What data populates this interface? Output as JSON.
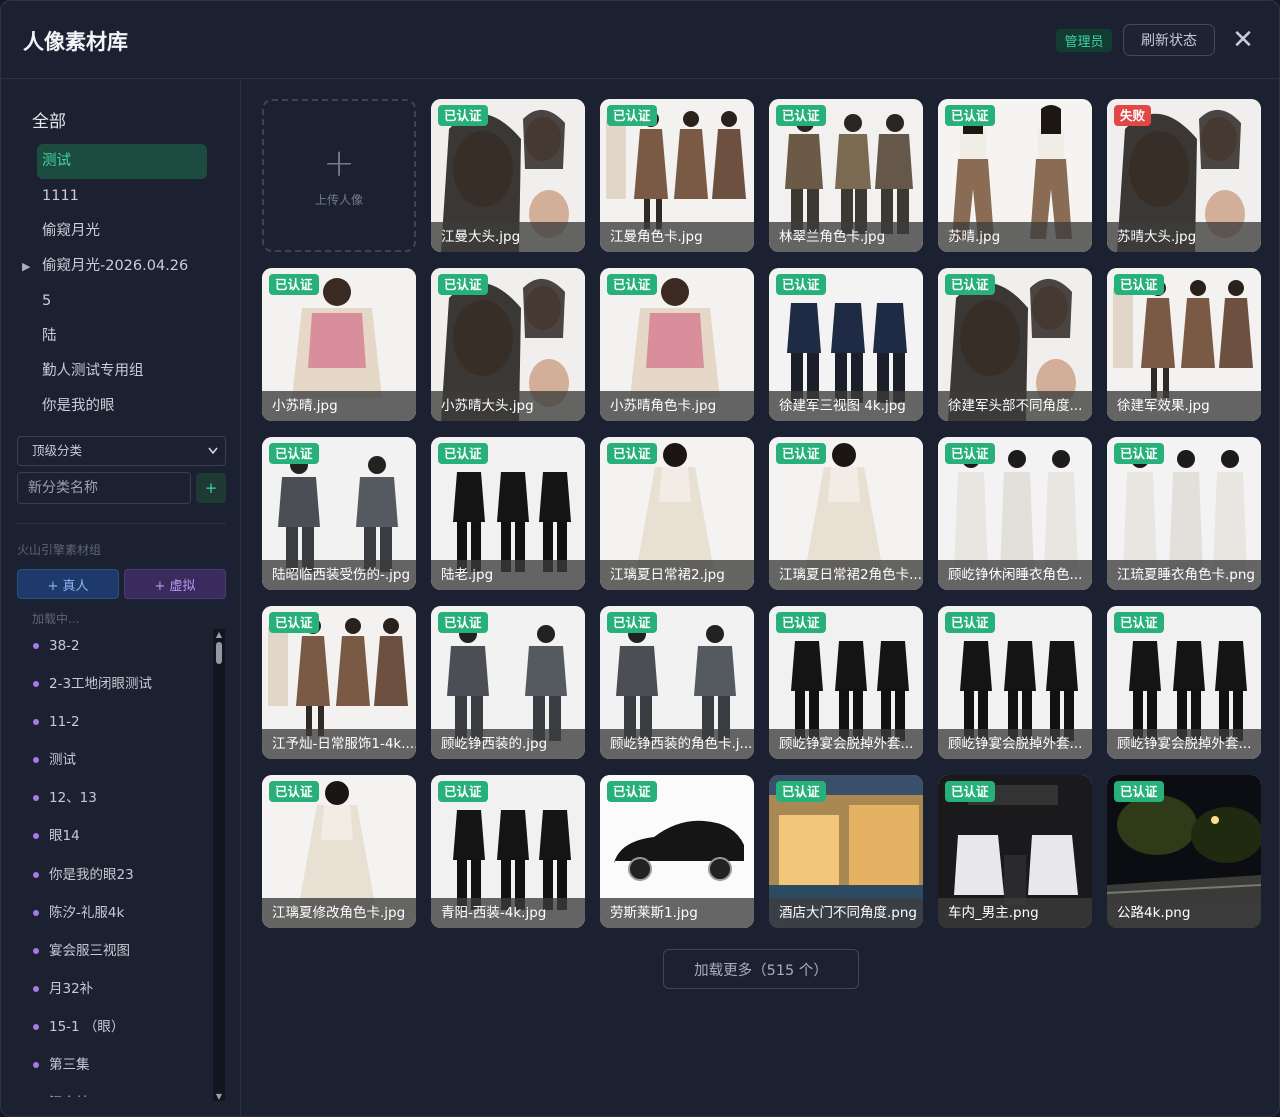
{
  "header": {
    "title": "人像素材库",
    "admin_badge": "管理员",
    "refresh_label": "刷新状态",
    "close_glyph": "✕"
  },
  "sidebar": {
    "all_label": "全部",
    "categories": [
      {
        "label": "测试",
        "active": true,
        "expandable": false
      },
      {
        "label": "1111",
        "active": false,
        "expandable": false
      },
      {
        "label": "偷窥月光",
        "active": false,
        "expandable": false
      },
      {
        "label": "偷窥月光-2026.04.26",
        "active": false,
        "expandable": true
      },
      {
        "label": "5",
        "active": false,
        "expandable": false
      },
      {
        "label": "陆",
        "active": false,
        "expandable": false
      },
      {
        "label": "勤人测试专用组",
        "active": false,
        "expandable": false
      },
      {
        "label": "你是我的眼",
        "active": false,
        "expandable": false
      }
    ],
    "expand_arrow": "▶",
    "parent_select": "顶级分类",
    "new_category_placeholder": "新分类名称",
    "add_category_glyph": "+",
    "group_title": "火山引擎素材组",
    "add_real_label": "+ 真人",
    "add_virtual_label": "+ 虚拟",
    "loading_text": "加载中...",
    "groups": [
      "38-2",
      "2-3工地闭眼测试",
      "11-2",
      "测试",
      "12、13",
      "眼14",
      "你是我的眼23",
      "陈汐-礼服4k",
      "宴会服三视图",
      "月32补",
      "15-1 （眼）",
      "第三集",
      "江宇灿一"
    ]
  },
  "grid": {
    "upload_label": "上传人像",
    "upload_glyph": "+",
    "items": [
      {
        "name": "江曼大头.jpg",
        "status": "已认证",
        "tone": "portrait-dark"
      },
      {
        "name": "江曼角色卡.jpg",
        "status": "已认证",
        "tone": "brown"
      },
      {
        "name": "林翠兰角色卡.jpg",
        "status": "已认证",
        "tone": "olive"
      },
      {
        "name": "苏晴.jpg",
        "status": "已认证",
        "tone": "tan"
      },
      {
        "name": "苏晴大头.jpg",
        "status": "失败",
        "tone": "portrait-dark"
      },
      {
        "name": "小苏晴.jpg",
        "status": "已认证",
        "tone": "pink"
      },
      {
        "name": "小苏晴大头.jpg",
        "status": "已认证",
        "tone": "portrait-dark"
      },
      {
        "name": "小苏晴角色卡.jpg",
        "status": "已认证",
        "tone": "pink"
      },
      {
        "name": "徐建军三视图 4k.jpg",
        "status": "已认证",
        "tone": "navy"
      },
      {
        "name": "徐建军头部不同角度...",
        "status": "已认证",
        "tone": "portrait-dark"
      },
      {
        "name": "徐建军效果.jpg",
        "status": "已认证",
        "tone": "brown"
      },
      {
        "name": "陆昭临西装受伤的-.jpg",
        "status": "已认证",
        "tone": "gray"
      },
      {
        "name": "陆老.jpg",
        "status": "已认证",
        "tone": "dark"
      },
      {
        "name": "江璃夏日常裙2.jpg",
        "status": "已认证",
        "tone": "cream"
      },
      {
        "name": "江璃夏日常裙2角色卡....",
        "status": "已认证",
        "tone": "cream"
      },
      {
        "name": "顾屹铮休闲睡衣角色...",
        "status": "已认证",
        "tone": "white"
      },
      {
        "name": "江琉夏睡衣角色卡.png",
        "status": "已认证",
        "tone": "white"
      },
      {
        "name": "江予灿-日常服饰1-4k....",
        "status": "已认证",
        "tone": "brown"
      },
      {
        "name": "顾屹铮西装的.jpg",
        "status": "已认证",
        "tone": "gray"
      },
      {
        "name": "顾屹铮西装的角色卡.j...",
        "status": "已认证",
        "tone": "gray"
      },
      {
        "name": "顾屹铮宴会脱掉外套...",
        "status": "已认证",
        "tone": "dark"
      },
      {
        "name": "顾屹铮宴会脱掉外套...",
        "status": "已认证",
        "tone": "dark"
      },
      {
        "name": "顾屹铮宴会脱掉外套...",
        "status": "已认证",
        "tone": "dark"
      },
      {
        "name": "江璃夏修改角色卡.jpg",
        "status": "已认证",
        "tone": "cream"
      },
      {
        "name": "青阳-西装-4k.jpg",
        "status": "已认证",
        "tone": "dark"
      },
      {
        "name": "劳斯莱斯1.jpg",
        "status": "已认证",
        "tone": "car"
      },
      {
        "name": "酒店大门不同角度.png",
        "status": "已认证",
        "tone": "hotel"
      },
      {
        "name": "车内_男主.png",
        "status": "已认证",
        "tone": "interior"
      },
      {
        "name": "公路4k.png",
        "status": "已认证",
        "tone": "night"
      }
    ]
  },
  "load_more_label": "加载更多（515 个）",
  "colors": {
    "accent_green": "#27b07a",
    "fail_red": "#e04747",
    "panel": "#1b2130",
    "active_bg": "#1c4b3f",
    "group_dot": "#a57be8"
  }
}
